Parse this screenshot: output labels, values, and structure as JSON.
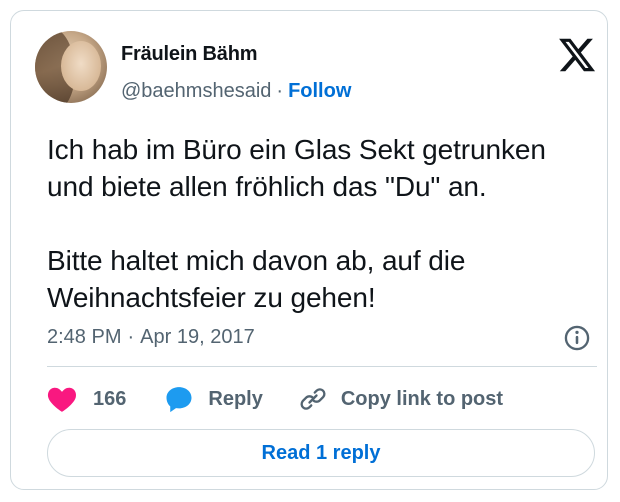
{
  "author": {
    "display_name": "Fräulein Bähm",
    "handle": "@baehmshesaid",
    "separator": "·",
    "follow_label": "Follow"
  },
  "tweet": {
    "paragraphs": [
      "Ich hab im Büro ein Glas Sekt getrunken und biete allen fröhlich das \"Du\" an.",
      "Bitte haltet mich davon ab, auf die Weihnachtsfeier zu gehen!"
    ],
    "time": "2:48 PM",
    "date_separator": "·",
    "date": "Apr 19, 2017"
  },
  "actions": {
    "like_count": "166",
    "reply_label": "Reply",
    "copy_link_label": "Copy link to post"
  },
  "read_replies_label": "Read 1 reply",
  "icons": {
    "logo": "x-logo-icon",
    "info": "info-icon",
    "like": "heart-icon",
    "reply": "speech-bubble-icon",
    "copy": "link-icon"
  },
  "colors": {
    "link": "#006fd6",
    "heart": "#f91880",
    "reply_bubble": "#1d9bf0",
    "muted_text": "#536471",
    "border": "#cfd9de"
  }
}
